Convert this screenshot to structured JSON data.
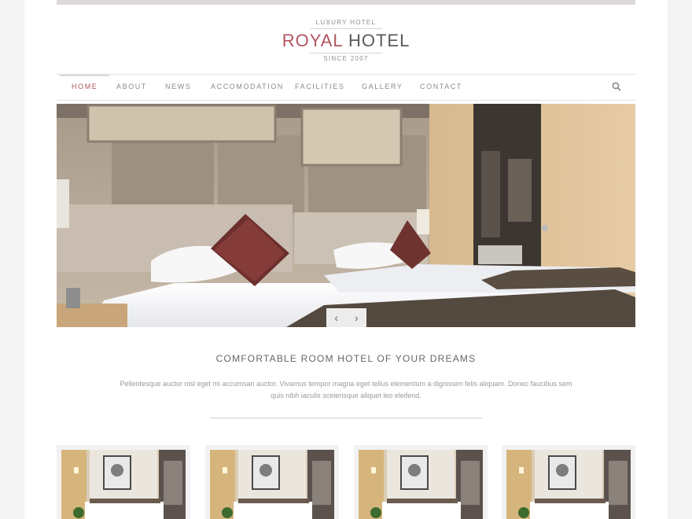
{
  "logo": {
    "tagline": "LUXURY HOTEL",
    "name_part1": "ROYAL",
    "name_part2": "HOTEL",
    "since": "SINCE 2007"
  },
  "nav": {
    "items": [
      {
        "label": "HOME",
        "active": true
      },
      {
        "label": "ABOUT"
      },
      {
        "label": "NEWS"
      },
      {
        "label": "ACCOMODATION"
      },
      {
        "label": "FACILITIES"
      },
      {
        "label": "GALLERY"
      },
      {
        "label": "CONTACT"
      }
    ],
    "search_icon": "search-icon"
  },
  "slider": {
    "prev": "‹",
    "next": "›"
  },
  "intro": {
    "heading": "COMFORTABLE ROOM HOTEL OF YOUR DREAMS",
    "text": "Pellentesque auctor nisl eget mi accumsan auctor. Vivamus tempor magna eget tellus elementum a dignissim felis aliquam. Donec faucibus sem quis nibh iaculis scelerisque aliquet leo eleifend."
  },
  "colors": {
    "accent": "#b0555f",
    "text": "#666666",
    "muted": "#9a9a9a"
  }
}
